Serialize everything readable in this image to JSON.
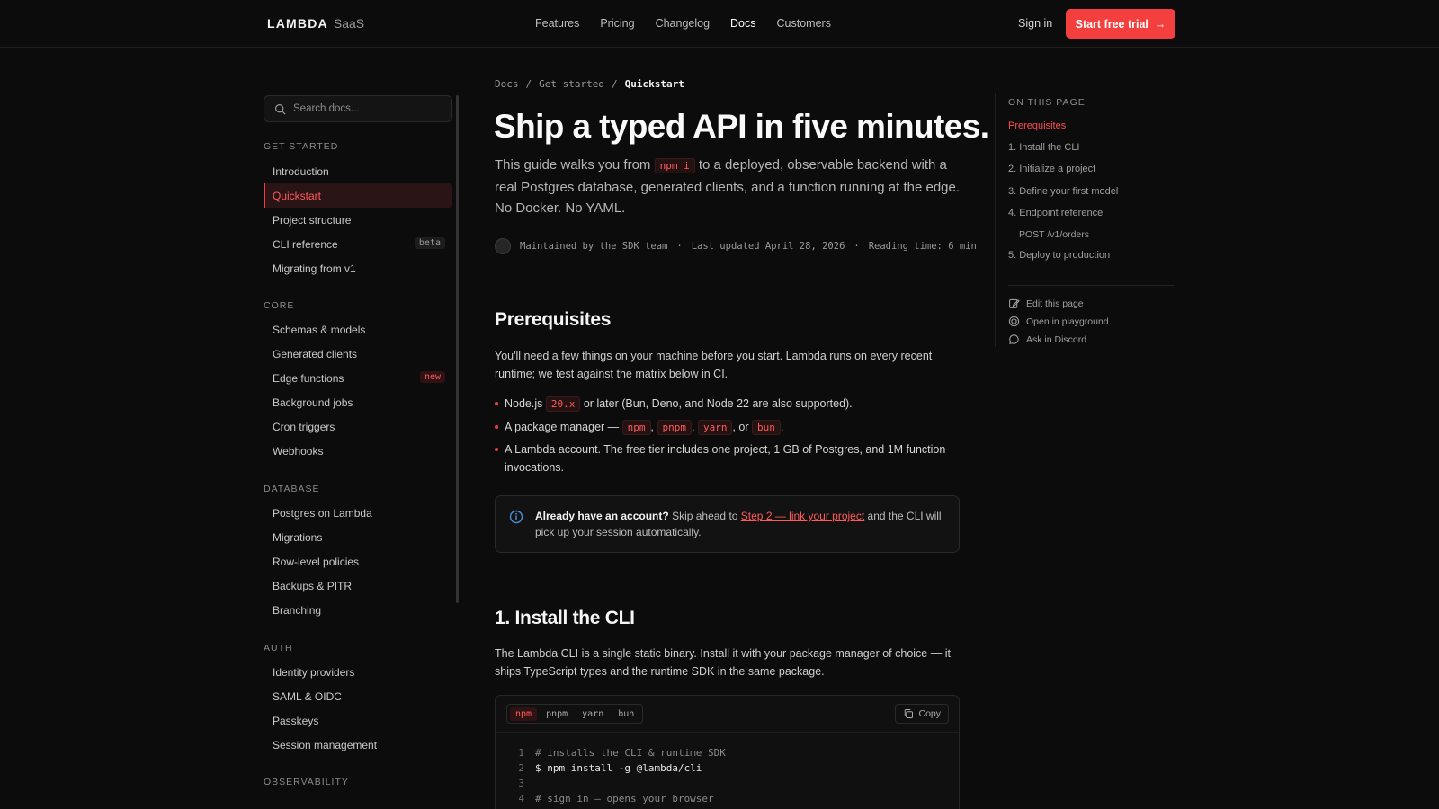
{
  "header": {
    "logo_brand": "LAMBDA",
    "logo_suffix": "SaaS",
    "nav": [
      "Features",
      "Pricing",
      "Changelog",
      "Docs",
      "Customers"
    ],
    "active_nav": "Docs",
    "signin": "Sign in",
    "cta": "Start free trial",
    "cta_arrow": "→"
  },
  "sidebar": {
    "search_placeholder": "Search docs...",
    "sections": [
      {
        "title": "GET STARTED",
        "items": [
          {
            "label": "Introduction"
          },
          {
            "label": "Quickstart",
            "active": true
          },
          {
            "label": "Project structure"
          },
          {
            "label": "CLI reference",
            "badge": "beta"
          },
          {
            "label": "Migrating from v1"
          }
        ]
      },
      {
        "title": "CORE",
        "items": [
          {
            "label": "Schemas & models"
          },
          {
            "label": "Generated clients"
          },
          {
            "label": "Edge functions",
            "badge": "new"
          },
          {
            "label": "Background jobs"
          },
          {
            "label": "Cron triggers"
          },
          {
            "label": "Webhooks"
          }
        ]
      },
      {
        "title": "DATABASE",
        "items": [
          {
            "label": "Postgres on Lambda"
          },
          {
            "label": "Migrations"
          },
          {
            "label": "Row-level policies"
          },
          {
            "label": "Backups & PITR"
          },
          {
            "label": "Branching"
          }
        ]
      },
      {
        "title": "AUTH",
        "items": [
          {
            "label": "Identity providers"
          },
          {
            "label": "SAML & OIDC"
          },
          {
            "label": "Passkeys"
          },
          {
            "label": "Session management"
          }
        ]
      },
      {
        "title": "OBSERVABILITY",
        "items": []
      }
    ]
  },
  "main": {
    "breadcrumb": [
      "Docs",
      "Get started",
      "Quickstart"
    ],
    "breadcrumb_sep": "/",
    "title": "Ship a typed API in five minutes.",
    "lead_before": "This guide walks you from",
    "lead_code": "npm i",
    "lead_after": "to a deployed, observable backend with a real Postgres database, generated clients, and a function running at the edge. No Docker. No YAML.",
    "meta": {
      "maintained": "Maintained by the SDK team",
      "dot": "·",
      "updated": "Last updated April 28, 2026",
      "reading": "Reading time: 6 min"
    },
    "prereq_heading": "Prerequisites",
    "prereq_text": "You'll need a few things on your machine before you start. Lambda runs on every recent runtime; we test against the matrix below in CI.",
    "bullet1": {
      "a": "Node.js",
      "code": "20.x",
      "b": "or later (Bun, Deno, and Node 22 are also supported)."
    },
    "bullet2": {
      "a": "A package manager —",
      "codes": [
        "npm",
        "pnpm",
        "yarn",
        "bun"
      ],
      "comma": ",",
      "or": ", or",
      "end": "."
    },
    "bullet3": "A Lambda account. The free tier includes one project, 1 GB of Postgres, and 1M function invocations.",
    "callout": {
      "bold": "Already have an account?",
      "text1": "Skip ahead to",
      "link": "Step 2 — link your project",
      "text2": "and the CLI will pick up your session automatically."
    },
    "install_heading": "1. Install the CLI",
    "install_text": "The Lambda CLI is a single static binary. Install it with your package manager of choice — it ships TypeScript types and the runtime SDK in the same package.",
    "code": {
      "tabs": [
        "npm",
        "pnpm",
        "yarn",
        "bun"
      ],
      "active_tab": "npm",
      "copy": "Copy",
      "lines": [
        {
          "n": "1",
          "text": "# installs the CLI & runtime SDK",
          "comment": true
        },
        {
          "n": "2",
          "text": "$ npm install -g @lambda/cli",
          "comment": false
        },
        {
          "n": "3",
          "text": "",
          "comment": false
        },
        {
          "n": "4",
          "text": "# sign in — opens your browser",
          "comment": true
        }
      ]
    }
  },
  "toc": {
    "title": "ON THIS PAGE",
    "items": [
      {
        "label": "Prerequisites",
        "active": true
      },
      {
        "label": "1. Install the CLI"
      },
      {
        "label": "2. Initialize a project"
      },
      {
        "label": "3. Define your first model"
      },
      {
        "label": "4. Endpoint reference"
      },
      {
        "label": "POST /v1/orders",
        "sub": true
      },
      {
        "label": "5. Deploy to production"
      }
    ],
    "actions": [
      {
        "label": "Edit this page",
        "icon": "edit-icon"
      },
      {
        "label": "Open in playground",
        "icon": "playground-icon"
      },
      {
        "label": "Ask in Discord",
        "icon": "chat-icon"
      }
    ]
  },
  "colors": {
    "accent": "#f43f3f",
    "background": "#0c0c0c"
  }
}
